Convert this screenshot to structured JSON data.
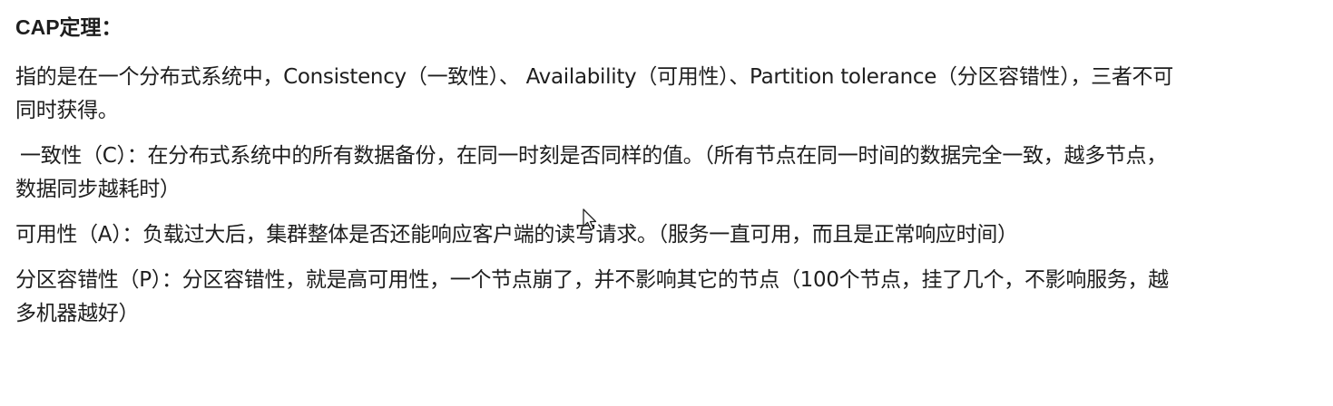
{
  "title": "CAP定理：",
  "paragraphs": [
    {
      "lines": [
        "指的是在一个分布式系统中，Consistency（一致性）、 Availability（可用性）、Partition tolerance（分区容错性），三者不可",
        "同时获得。"
      ]
    },
    {
      "lines": [
        "一致性（C）：在分布式系统中的所有数据备份，在同一时刻是否同样的值。（所有节点在同一时间的数据完全一致，越多节点，",
        "数据同步越耗时）"
      ]
    },
    {
      "lines": [
        "可用性（A）：负载过大后，集群整体是否还能响应客户端的读写请求。（服务一直可用，而且是正常响应时间）"
      ]
    },
    {
      "lines": [
        "分区容错性（P）：分区容错性，就是高可用性，一个节点崩了，并不影响其它的节点（100个节点，挂了几个，不影响服务，越",
        "多机器越好）"
      ]
    }
  ],
  "cursor": {
    "icon": "mouse-pointer-icon"
  }
}
